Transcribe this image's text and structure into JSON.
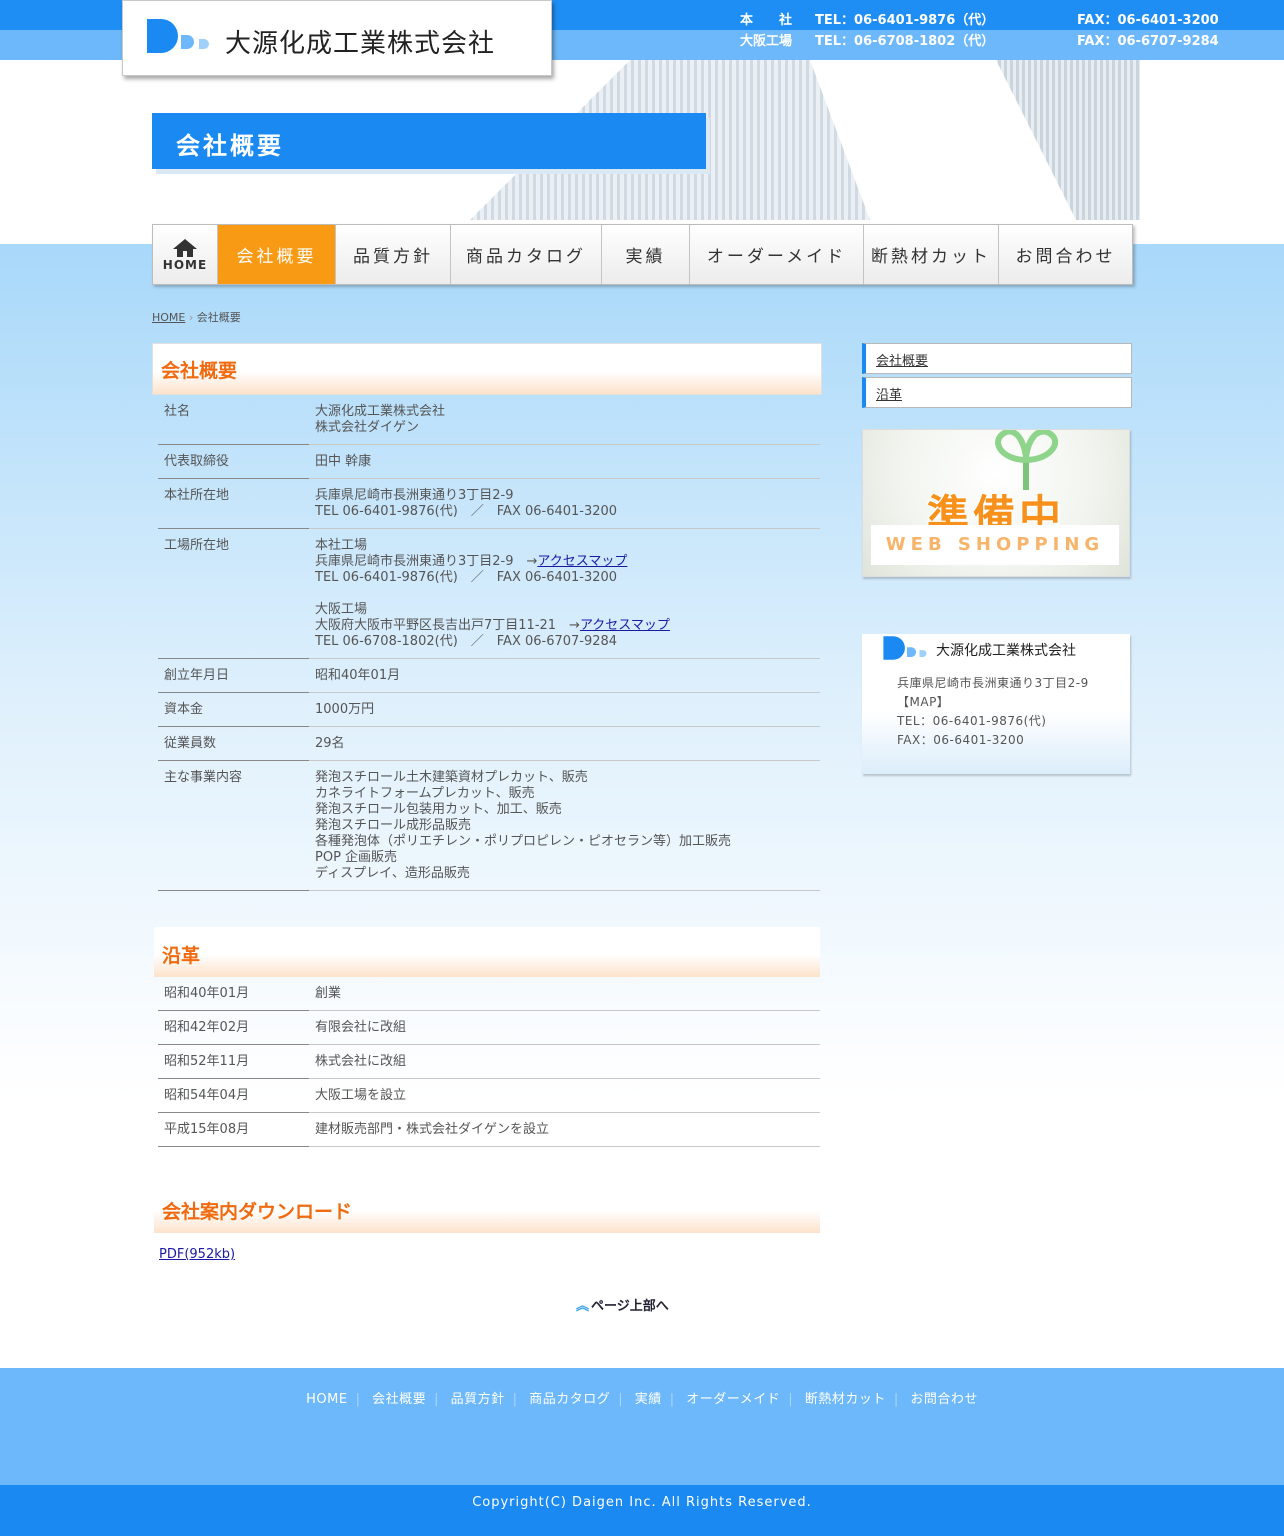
{
  "header": {
    "company_name": "大源化成工業株式会社",
    "contacts": [
      {
        "label": "本　　社",
        "tel": "TEL：06-6401-9876（代）",
        "fax": "FAX：06-6401-3200"
      },
      {
        "label": "大阪工場",
        "tel": "TEL：06-6708-1802（代）",
        "fax": "FAX：06-6707-9284"
      }
    ],
    "page_banner": "会社概要"
  },
  "nav": {
    "home": "HOME",
    "items": [
      "会社概要",
      "品質方針",
      "商品カタログ",
      "実績",
      "オーダーメイド",
      "断熱材カット",
      "お問合わせ"
    ]
  },
  "breadcrumb": {
    "home": "HOME",
    "current": "会社概要"
  },
  "overview": {
    "title": "会社概要",
    "rows": [
      {
        "key": "社名",
        "lines": [
          "大源化成工業株式会社",
          "株式会社ダイゲン"
        ]
      },
      {
        "key": "代表取締役",
        "lines": [
          "田中 幹康"
        ]
      },
      {
        "key": "本社所在地",
        "lines": [
          "兵庫県尼崎市長洲東通り3丁目2-9",
          "TEL 06-6401-9876(代)　／　FAX 06-6401-3200"
        ]
      },
      {
        "key": "工場所在地",
        "factory1_name": "本社工場",
        "factory1_addr": "兵庫県尼崎市長洲東通り3丁目2-9　→",
        "factory1_link": "アクセスマップ",
        "factory1_tel": "TEL 06-6401-9876(代)　／　FAX 06-6401-3200",
        "factory2_name": "大阪工場",
        "factory2_addr": "大阪府大阪市平野区長吉出戸7丁目11-21　→",
        "factory2_link": "アクセスマップ",
        "factory2_tel": "TEL 06-6708-1802(代)　／　FAX 06-6707-9284"
      },
      {
        "key": "創立年月日",
        "lines": [
          "昭和40年01月"
        ]
      },
      {
        "key": "資本金",
        "lines": [
          "1000万円"
        ]
      },
      {
        "key": "従業員数",
        "lines": [
          "29名"
        ]
      },
      {
        "key": "主な事業内容",
        "lines": [
          "発泡スチロール土木建築資材プレカット、販売",
          "カネライトフォームプレカット、販売",
          "発泡スチロール包装用カット、加工、販売",
          "発泡スチロール成形品販売",
          "各種発泡体（ポリエチレン・ポリプロピレン・ピオセラン等）加工販売",
          "POP 企画販売",
          "ディスプレイ、造形品販売"
        ]
      }
    ]
  },
  "history": {
    "title": "沿革",
    "rows": [
      {
        "date": "昭和40年01月",
        "event": "創業"
      },
      {
        "date": "昭和42年02月",
        "event": "有限会社に改組"
      },
      {
        "date": "昭和52年11月",
        "event": "株式会社に改組"
      },
      {
        "date": "昭和54年04月",
        "event": "大阪工場を設立"
      },
      {
        "date": "平成15年08月",
        "event": "建材販売部門・株式会社ダイゲンを設立"
      }
    ]
  },
  "download": {
    "title": "会社案内ダウンロード",
    "link": "PDF(952kb)"
  },
  "page_top": "ページ上部へ",
  "sidebar": {
    "links": [
      "会社概要",
      "沿革"
    ],
    "shop_banner": {
      "main": "準備中",
      "sub": "WEB SHOPPING"
    },
    "card": {
      "company_name": "大源化成工業株式会社",
      "address": "兵庫県尼崎市長洲東通り3丁目2-9",
      "map": "【MAP】",
      "tel": "TEL：06-6401-9876(代)",
      "fax": "FAX：06-6401-3200"
    }
  },
  "footer": {
    "nav": [
      "HOME",
      "会社概要",
      "品質方針",
      "商品カタログ",
      "実績",
      "オーダーメイド",
      "断熱材カット",
      "お問合わせ"
    ],
    "separator": "|",
    "copyright": "Copyright(C) Daigen Inc. All Rights Reserved."
  },
  "colors": {
    "primary_blue": "#1a8af2",
    "light_blue": "#6cb8fa",
    "accent_orange": "#f99a14",
    "heading_orange": "#f06b10"
  }
}
